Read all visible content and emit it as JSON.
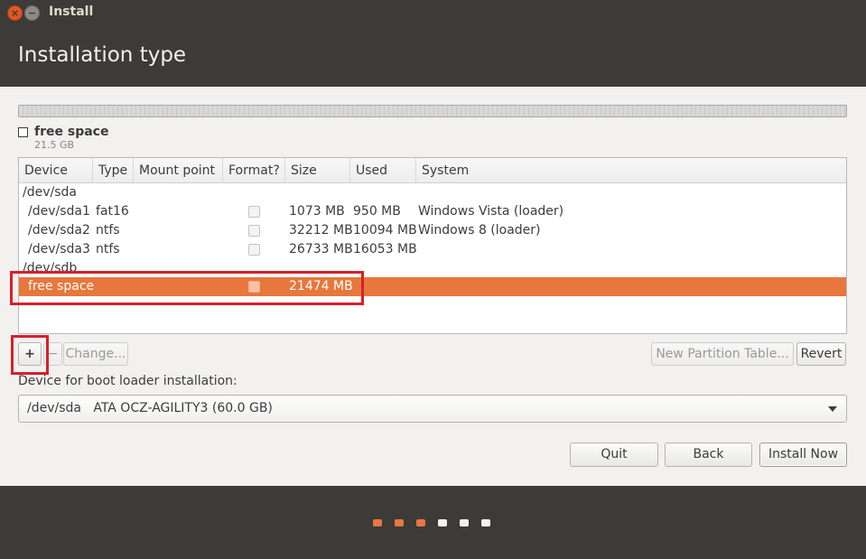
{
  "window": {
    "title": "Install"
  },
  "header": {
    "title": "Installation type"
  },
  "disk": {
    "legend_label": "free space",
    "legend_size": "21.5 GB"
  },
  "table": {
    "columns": [
      "Device",
      "Type",
      "Mount point",
      "Format?",
      "Size",
      "Used",
      "System"
    ],
    "rows": [
      {
        "device": "/dev/sda",
        "type": "",
        "mount": "",
        "format": false,
        "size": "",
        "used": "",
        "system": ""
      },
      {
        "device": "/dev/sda1",
        "type": "fat16",
        "mount": "",
        "format": true,
        "size": "1073 MB",
        "used": "950 MB",
        "system": "Windows Vista (loader)"
      },
      {
        "device": "/dev/sda2",
        "type": "ntfs",
        "mount": "",
        "format": true,
        "size": "32212 MB",
        "used": "10094 MB",
        "system": "Windows 8 (loader)"
      },
      {
        "device": "/dev/sda3",
        "type": "ntfs",
        "mount": "",
        "format": true,
        "size": "26733 MB",
        "used": "16053 MB",
        "system": ""
      },
      {
        "device": "/dev/sdb",
        "type": "",
        "mount": "",
        "format": false,
        "size": "",
        "used": "",
        "system": ""
      },
      {
        "device": "free space",
        "type": "",
        "mount": "",
        "format": true,
        "size": "21474 MB",
        "used": "",
        "system": "",
        "selected": true
      }
    ]
  },
  "partition_toolbar": {
    "add_label": "+",
    "remove_label": "−",
    "change_label": "Change...",
    "new_table_label": "New Partition Table...",
    "revert_label": "Revert"
  },
  "bootloader": {
    "label": "Device for boot loader installation:",
    "selected_value": "/dev/sda   ATA OCZ-AGILITY3 (60.0 GB)"
  },
  "actions": {
    "quit_label": "Quit",
    "back_label": "Back",
    "install_label": "Install Now"
  },
  "progress": {
    "total_steps": 6,
    "completed_steps": 3
  },
  "colors": {
    "accent": "#e7773d",
    "chrome": "#3c3b37",
    "highlight": "#d6202a",
    "dot_inactive": "#f2f1f0"
  }
}
